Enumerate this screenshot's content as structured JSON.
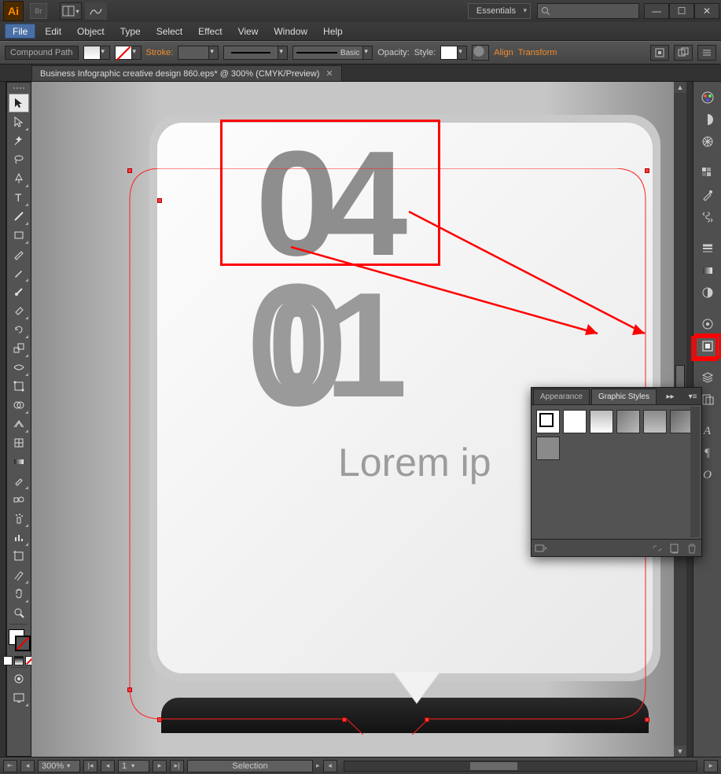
{
  "titlebar": {
    "ai_logo": "Ai",
    "br_logo": "Br",
    "workspace": "Essentials"
  },
  "menus": [
    "File",
    "Edit",
    "Object",
    "Type",
    "Select",
    "Effect",
    "View",
    "Window",
    "Help"
  ],
  "controlbar": {
    "context_label": "Compound Path",
    "stroke_label": "Stroke:",
    "brush_label": "Basic",
    "opacity_label": "Opacity:",
    "style_label": "Style:",
    "align_link": "Align",
    "transform_link": "Transform"
  },
  "document": {
    "tab_title": "Business Infographic creative design 860.eps* @ 300% (CMYK/Preview)"
  },
  "artwork": {
    "num_04": "04",
    "num_01": "01",
    "lorem": "Lorem ip"
  },
  "graphic_styles_panel": {
    "tabs": [
      "Appearance",
      "Graphic Styles"
    ]
  },
  "statusbar": {
    "zoom": "300%",
    "page": "1",
    "tool": "Selection"
  }
}
